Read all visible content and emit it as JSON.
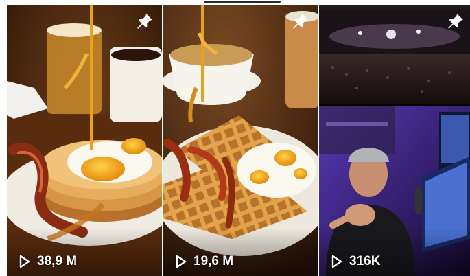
{
  "tiles": [
    {
      "views": "38,9 M",
      "pinned": true,
      "pin_icon": "pin-icon",
      "play_icon": "play-icon"
    },
    {
      "views": "19,6 M",
      "pinned": true,
      "pin_icon": "pin-icon",
      "play_icon": "play-icon"
    },
    {
      "views": "316K",
      "pinned": true,
      "pin_icon": "pin-icon",
      "play_icon": "play-icon"
    }
  ],
  "colors": {
    "overlay_text": "#ffffff",
    "background": "#ffffff"
  }
}
